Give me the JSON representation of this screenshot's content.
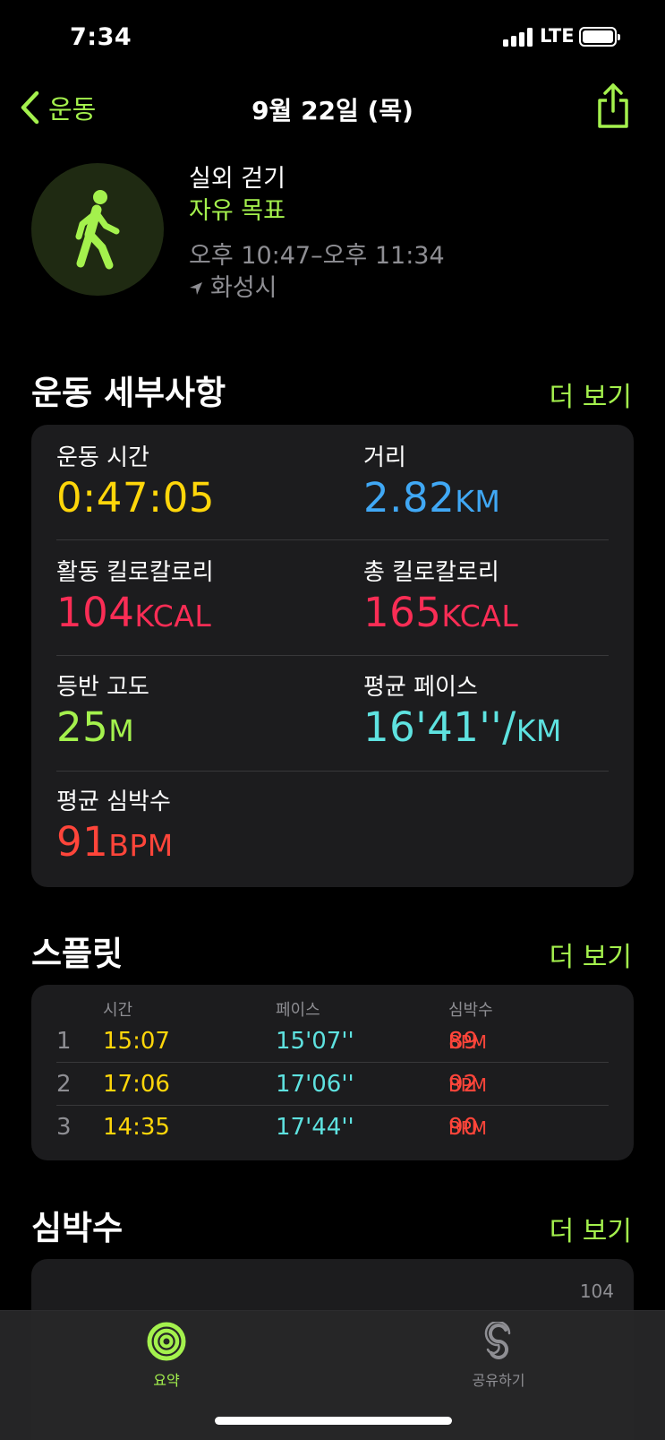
{
  "status": {
    "time": "7:34",
    "network": "LTE"
  },
  "nav": {
    "back_label": "운동",
    "title": "9월 22일 (목)"
  },
  "workout": {
    "type": "실외 걷기",
    "goal": "자유 목표",
    "time_range": "오후 10:47–오후 11:34",
    "location": "화성시"
  },
  "details": {
    "title": "운동 세부사항",
    "more": "더 보기",
    "metrics": [
      {
        "label": "운동 시간",
        "value": "0:47:05",
        "unit": "",
        "color": "#ffd60a"
      },
      {
        "label": "거리",
        "value": "2.82",
        "unit": "KM",
        "color": "#40a8f5"
      },
      {
        "label": "활동 킬로칼로리",
        "value": "104",
        "unit": "KCAL",
        "color": "#fa2d55"
      },
      {
        "label": "총 킬로칼로리",
        "value": "165",
        "unit": "KCAL",
        "color": "#fa2d55"
      },
      {
        "label": "등반 고도",
        "value": "25",
        "unit": "M",
        "color": "#a4f14d"
      },
      {
        "label": "평균 페이스",
        "value": "16'41''/",
        "unit": "KM",
        "color": "#5ee2e0"
      },
      {
        "label": "평균 심박수",
        "value": "91",
        "unit": "BPM",
        "color": "#ff453a"
      }
    ]
  },
  "splits": {
    "title": "스플릿",
    "more": "더 보기",
    "columns": [
      "시간",
      "페이스",
      "심박수"
    ],
    "rows": [
      {
        "index": "1",
        "time": "15:07",
        "pace": "15'07''",
        "hr": "89",
        "hr_unit": "BPM"
      },
      {
        "index": "2",
        "time": "17:06",
        "pace": "17'06''",
        "hr": "92",
        "hr_unit": "BPM"
      },
      {
        "index": "3",
        "time": "14:35",
        "pace": "17'44''",
        "hr": "90",
        "hr_unit": "BPM"
      }
    ],
    "colors": {
      "time": "#ffd60a",
      "pace": "#5ee2e0",
      "hr": "#ff453a"
    }
  },
  "heart_rate": {
    "title": "심박수",
    "more": "더 보기",
    "max_value": "104"
  },
  "tabs": [
    {
      "label": "요약",
      "icon": "activity-rings-icon",
      "active": true
    },
    {
      "label": "공유하기",
      "icon": "sharing-icon",
      "active": false
    }
  ],
  "accent": "#a4f14d"
}
